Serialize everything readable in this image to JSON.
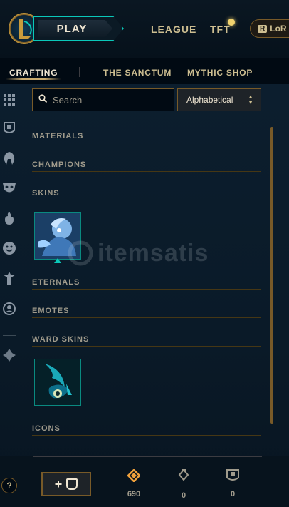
{
  "topbar": {
    "play_label": "PLAY",
    "nav": [
      "LEAGUE",
      "TFT"
    ],
    "lor_label": "LoR",
    "lor_badge": "R"
  },
  "tabs": [
    {
      "label": "CRAFTING",
      "active": true
    },
    {
      "label": "THE SANCTUM",
      "active": false
    },
    {
      "label": "MYTHIC SHOP",
      "active": false
    }
  ],
  "sidebar": {
    "icons": [
      "grid-icon",
      "chest-icon",
      "helmet-icon",
      "mask-icon",
      "flame-icon",
      "emote-icon",
      "ward-icon",
      "profile-icon",
      "filter-icon"
    ]
  },
  "search": {
    "placeholder": "Search"
  },
  "sort": {
    "value": "Alphabetical"
  },
  "sections": [
    "MATERIALS",
    "CHAMPIONS",
    "SKINS",
    "ETERNALS",
    "EMOTES",
    "WARD SKINS",
    "ICONS"
  ],
  "watermark": {
    "text": "itemsatis"
  },
  "bottom": {
    "help_label": "?",
    "craft_label": "+",
    "currencies": [
      {
        "icon": "orange-essence-icon",
        "value": "690",
        "color": "#f0a13c"
      },
      {
        "icon": "key-icon",
        "value": "0",
        "color": "#a09b8c"
      },
      {
        "icon": "chest-icon",
        "value": "0",
        "color": "#a09b8c"
      }
    ]
  },
  "colors": {
    "gold": "#c8aa6e",
    "teal": "#0ac8b9",
    "background": "#010a13"
  }
}
